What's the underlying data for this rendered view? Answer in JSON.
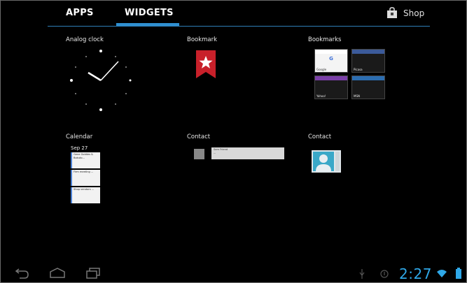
{
  "header": {
    "tabs": [
      {
        "label": "APPS",
        "selected": false
      },
      {
        "label": "WIDGETS",
        "selected": true
      }
    ],
    "shop_label": "Shop",
    "accent_color": "#2f8fd0"
  },
  "widgets": [
    {
      "label": "Analog clock",
      "icon": "analog-clock-icon"
    },
    {
      "label": "Bookmark",
      "icon": "bookmark-star-icon"
    },
    {
      "label": "Bookmarks",
      "icon": "bookmark-thumbnails"
    },
    {
      "label": "Calendar",
      "icon": "calendar-preview"
    },
    {
      "label": "Contact",
      "icon": "contact-list-preview"
    },
    {
      "label": "Contact",
      "icon": "contact-card-icon"
    }
  ],
  "bookmarks_preview": [
    "Google",
    "Picasa",
    "Yahoo!",
    "MSN"
  ],
  "calendar_preview": {
    "date": "Sep 27",
    "events": [
      "Gene Goldies & Bokuto...",
      "Firm meeting ...",
      "Shop vendors ..."
    ]
  },
  "contact_preview": {
    "name": "Sam Friend",
    "status": "..."
  },
  "status_bar": {
    "time": "2:27"
  }
}
